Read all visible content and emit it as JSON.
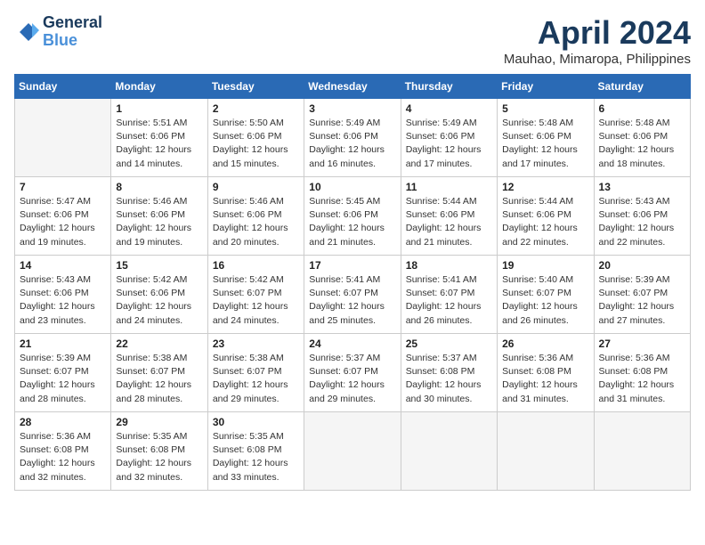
{
  "header": {
    "logo_line1": "General",
    "logo_line2": "Blue",
    "month": "April 2024",
    "location": "Mauhao, Mimaropa, Philippines"
  },
  "weekdays": [
    "Sunday",
    "Monday",
    "Tuesday",
    "Wednesday",
    "Thursday",
    "Friday",
    "Saturday"
  ],
  "weeks": [
    [
      {
        "day": "",
        "info": ""
      },
      {
        "day": "1",
        "info": "Sunrise: 5:51 AM\nSunset: 6:06 PM\nDaylight: 12 hours\nand 14 minutes."
      },
      {
        "day": "2",
        "info": "Sunrise: 5:50 AM\nSunset: 6:06 PM\nDaylight: 12 hours\nand 15 minutes."
      },
      {
        "day": "3",
        "info": "Sunrise: 5:49 AM\nSunset: 6:06 PM\nDaylight: 12 hours\nand 16 minutes."
      },
      {
        "day": "4",
        "info": "Sunrise: 5:49 AM\nSunset: 6:06 PM\nDaylight: 12 hours\nand 17 minutes."
      },
      {
        "day": "5",
        "info": "Sunrise: 5:48 AM\nSunset: 6:06 PM\nDaylight: 12 hours\nand 17 minutes."
      },
      {
        "day": "6",
        "info": "Sunrise: 5:48 AM\nSunset: 6:06 PM\nDaylight: 12 hours\nand 18 minutes."
      }
    ],
    [
      {
        "day": "7",
        "info": "Sunrise: 5:47 AM\nSunset: 6:06 PM\nDaylight: 12 hours\nand 19 minutes."
      },
      {
        "day": "8",
        "info": "Sunrise: 5:46 AM\nSunset: 6:06 PM\nDaylight: 12 hours\nand 19 minutes."
      },
      {
        "day": "9",
        "info": "Sunrise: 5:46 AM\nSunset: 6:06 PM\nDaylight: 12 hours\nand 20 minutes."
      },
      {
        "day": "10",
        "info": "Sunrise: 5:45 AM\nSunset: 6:06 PM\nDaylight: 12 hours\nand 21 minutes."
      },
      {
        "day": "11",
        "info": "Sunrise: 5:44 AM\nSunset: 6:06 PM\nDaylight: 12 hours\nand 21 minutes."
      },
      {
        "day": "12",
        "info": "Sunrise: 5:44 AM\nSunset: 6:06 PM\nDaylight: 12 hours\nand 22 minutes."
      },
      {
        "day": "13",
        "info": "Sunrise: 5:43 AM\nSunset: 6:06 PM\nDaylight: 12 hours\nand 22 minutes."
      }
    ],
    [
      {
        "day": "14",
        "info": "Sunrise: 5:43 AM\nSunset: 6:06 PM\nDaylight: 12 hours\nand 23 minutes."
      },
      {
        "day": "15",
        "info": "Sunrise: 5:42 AM\nSunset: 6:06 PM\nDaylight: 12 hours\nand 24 minutes."
      },
      {
        "day": "16",
        "info": "Sunrise: 5:42 AM\nSunset: 6:07 PM\nDaylight: 12 hours\nand 24 minutes."
      },
      {
        "day": "17",
        "info": "Sunrise: 5:41 AM\nSunset: 6:07 PM\nDaylight: 12 hours\nand 25 minutes."
      },
      {
        "day": "18",
        "info": "Sunrise: 5:41 AM\nSunset: 6:07 PM\nDaylight: 12 hours\nand 26 minutes."
      },
      {
        "day": "19",
        "info": "Sunrise: 5:40 AM\nSunset: 6:07 PM\nDaylight: 12 hours\nand 26 minutes."
      },
      {
        "day": "20",
        "info": "Sunrise: 5:39 AM\nSunset: 6:07 PM\nDaylight: 12 hours\nand 27 minutes."
      }
    ],
    [
      {
        "day": "21",
        "info": "Sunrise: 5:39 AM\nSunset: 6:07 PM\nDaylight: 12 hours\nand 28 minutes."
      },
      {
        "day": "22",
        "info": "Sunrise: 5:38 AM\nSunset: 6:07 PM\nDaylight: 12 hours\nand 28 minutes."
      },
      {
        "day": "23",
        "info": "Sunrise: 5:38 AM\nSunset: 6:07 PM\nDaylight: 12 hours\nand 29 minutes."
      },
      {
        "day": "24",
        "info": "Sunrise: 5:37 AM\nSunset: 6:07 PM\nDaylight: 12 hours\nand 29 minutes."
      },
      {
        "day": "25",
        "info": "Sunrise: 5:37 AM\nSunset: 6:08 PM\nDaylight: 12 hours\nand 30 minutes."
      },
      {
        "day": "26",
        "info": "Sunrise: 5:36 AM\nSunset: 6:08 PM\nDaylight: 12 hours\nand 31 minutes."
      },
      {
        "day": "27",
        "info": "Sunrise: 5:36 AM\nSunset: 6:08 PM\nDaylight: 12 hours\nand 31 minutes."
      }
    ],
    [
      {
        "day": "28",
        "info": "Sunrise: 5:36 AM\nSunset: 6:08 PM\nDaylight: 12 hours\nand 32 minutes."
      },
      {
        "day": "29",
        "info": "Sunrise: 5:35 AM\nSunset: 6:08 PM\nDaylight: 12 hours\nand 32 minutes."
      },
      {
        "day": "30",
        "info": "Sunrise: 5:35 AM\nSunset: 6:08 PM\nDaylight: 12 hours\nand 33 minutes."
      },
      {
        "day": "",
        "info": ""
      },
      {
        "day": "",
        "info": ""
      },
      {
        "day": "",
        "info": ""
      },
      {
        "day": "",
        "info": ""
      }
    ]
  ]
}
